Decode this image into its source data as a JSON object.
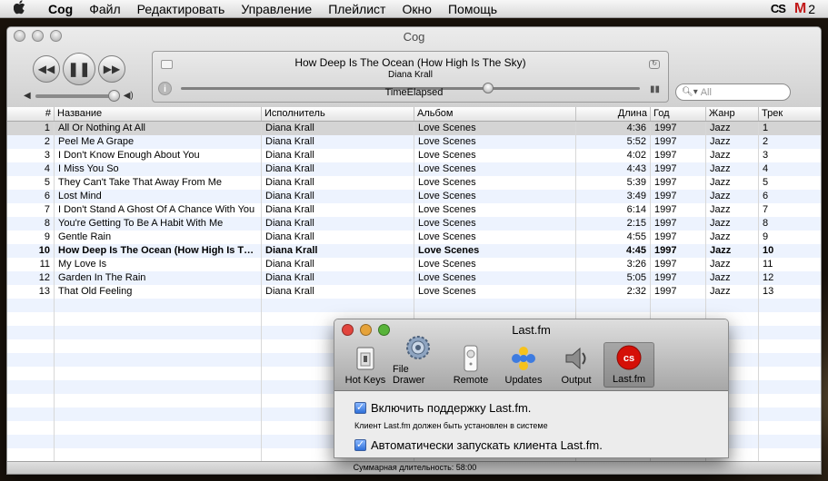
{
  "menubar": {
    "items": [
      "Cog",
      "Файл",
      "Редактировать",
      "Управление",
      "Плейлист",
      "Окно",
      "Помощь"
    ],
    "extras": {
      "lastfm": "CS",
      "gmail_letter": "M",
      "gmail_count": "2"
    }
  },
  "window": {
    "title": "Cog"
  },
  "now_playing": {
    "title": "How Deep Is The Ocean (How High Is The Sky)",
    "artist": "Diana Krall",
    "time_label": "TimeElapsed",
    "progress": 0.67,
    "volume": 0.95
  },
  "search": {
    "placeholder": "All"
  },
  "table": {
    "columns": [
      "#",
      "Название",
      "Исполнитель",
      "Альбом",
      "Длина",
      "Год",
      "Жанр",
      "Трек"
    ],
    "rows": [
      [
        "1",
        "All Or Nothing At All",
        "Diana Krall",
        "Love Scenes",
        "4:36",
        "1997",
        "Jazz",
        "1"
      ],
      [
        "2",
        "Peel Me A Grape",
        "Diana Krall",
        "Love Scenes",
        "5:52",
        "1997",
        "Jazz",
        "2"
      ],
      [
        "3",
        "I Don't Know Enough About You",
        "Diana Krall",
        "Love Scenes",
        "4:02",
        "1997",
        "Jazz",
        "3"
      ],
      [
        "4",
        "I Miss You So",
        "Diana Krall",
        "Love Scenes",
        "4:43",
        "1997",
        "Jazz",
        "4"
      ],
      [
        "5",
        "They Can't Take That Away From Me",
        "Diana Krall",
        "Love Scenes",
        "5:39",
        "1997",
        "Jazz",
        "5"
      ],
      [
        "6",
        "Lost Mind",
        "Diana Krall",
        "Love Scenes",
        "3:49",
        "1997",
        "Jazz",
        "6"
      ],
      [
        "7",
        "I Don't Stand A Ghost Of A Chance With You",
        "Diana Krall",
        "Love Scenes",
        "6:14",
        "1997",
        "Jazz",
        "7"
      ],
      [
        "8",
        "You're Getting To Be A Habit With Me",
        "Diana Krall",
        "Love Scenes",
        "2:15",
        "1997",
        "Jazz",
        "8"
      ],
      [
        "9",
        "Gentle Rain",
        "Diana Krall",
        "Love Scenes",
        "4:55",
        "1997",
        "Jazz",
        "9"
      ],
      [
        "10",
        "How Deep Is The Ocean (How High Is The Sky)",
        "Diana Krall",
        "Love Scenes",
        "4:45",
        "1997",
        "Jazz",
        "10"
      ],
      [
        "11",
        "My Love Is",
        "Diana Krall",
        "Love Scenes",
        "3:26",
        "1997",
        "Jazz",
        "11"
      ],
      [
        "12",
        "Garden In The Rain",
        "Diana Krall",
        "Love Scenes",
        "5:05",
        "1997",
        "Jazz",
        "12"
      ],
      [
        "13",
        "That Old Feeling",
        "Diana Krall",
        "Love Scenes",
        "2:32",
        "1997",
        "Jazz",
        "13"
      ]
    ],
    "selected_row": 0,
    "playing_row": 9
  },
  "status": {
    "text": "Суммарная длительность: 58:00"
  },
  "prefs": {
    "title": "Last.fm",
    "toolbar": [
      "Hot Keys",
      "File Drawer",
      "Remote",
      "Updates",
      "Output",
      "Last.fm"
    ],
    "enable_label": "Включить поддержку Last.fm.",
    "note": "Клиент Last.fm должен быть установлен в системе",
    "autostart_label": "Автоматически запускать клиента Last.fm.",
    "colors": {
      "close": "#e2453d",
      "minimize": "#e6a33a",
      "zoom": "#58b43a",
      "lastfm": "#d51007"
    }
  }
}
